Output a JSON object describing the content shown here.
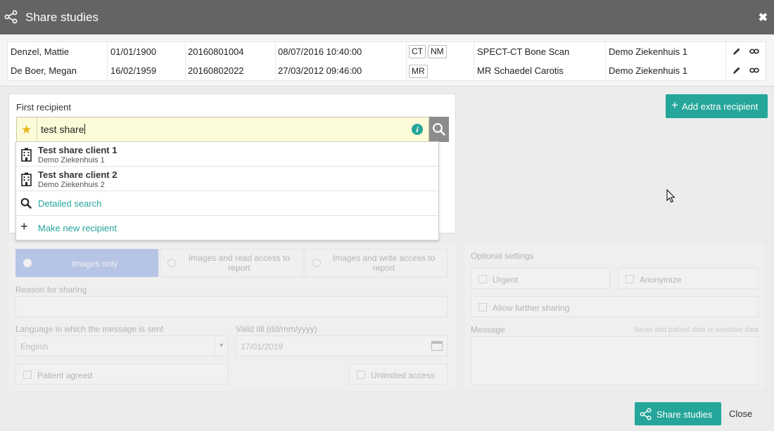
{
  "dialog": {
    "title": "Share studies",
    "close_glyph": "✖"
  },
  "studies": [
    {
      "patient": "Denzel, Mattie",
      "birth_date": "01/01/1900",
      "accession": "20160801004",
      "study_date": "08/07/2016 10:40:00",
      "modalities": [
        "CT",
        "NM"
      ],
      "description": "SPECT-CT Bone Scan",
      "institution": "Demo Ziekenhuis 1"
    },
    {
      "patient": "De Boer, Megan",
      "birth_date": "16/02/1959",
      "accession": "20160802022",
      "study_date": "27/03/2012 09:46:00",
      "modalities": [
        "MR"
      ],
      "description": "MR Schaedel Carotis",
      "institution": "Demo Ziekenhuis 1"
    }
  ],
  "recipient": {
    "label": "First recipient",
    "search_value": "test share",
    "info_glyph": "i",
    "add_extra_label": "Add extra recipient",
    "add_extra_glyph": "+"
  },
  "dropdown": {
    "results": [
      {
        "name": "Test share client 1",
        "institution": "Demo Ziekenhuis 1"
      },
      {
        "name": "Test share client 2",
        "institution": "Demo Ziekenhuis 2"
      }
    ],
    "detailed_search": "Detailed search",
    "make_new": "Make new recipient",
    "make_new_glyph": "+"
  },
  "form": {
    "access_options": [
      "Images only",
      "Images and read access to report",
      "Images and write access to report"
    ],
    "reason_label": "Reason for sharing",
    "language_label": "Language in which the message is sent",
    "language_value": "English",
    "valid_till_label": "Valid till (dd/mm/yyyy)",
    "valid_till_value": "17/01/2019",
    "patient_agreed": "Patient agreed",
    "unlimited_access": "Unlimited access",
    "optional_settings": "Optional settings",
    "urgent": "Urgent",
    "anonymize": "Anonymize",
    "allow_further_sharing": "Allow further sharing",
    "message_label": "Message",
    "message_hint": "Never add patient data or sensitive data"
  },
  "footer": {
    "share_label": "Share studies",
    "close_label": "Close"
  },
  "colors": {
    "accent": "#26a69a",
    "header": "#646464",
    "selected_option": "#3b6fd8",
    "star": "#e5b41a"
  }
}
